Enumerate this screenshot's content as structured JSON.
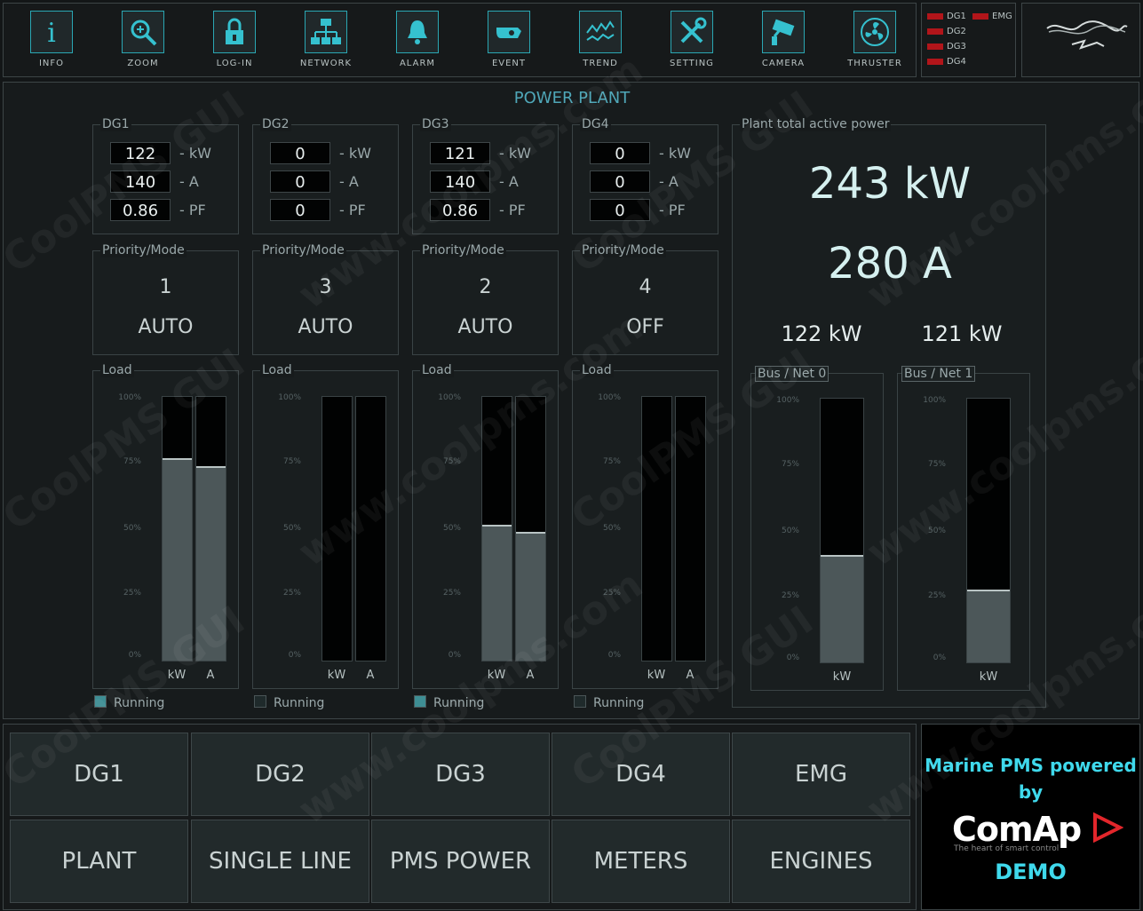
{
  "toolbar": [
    {
      "label": "INFO",
      "icon": "info-icon"
    },
    {
      "label": "ZOOM",
      "icon": "zoom-icon"
    },
    {
      "label": "LOG-IN",
      "icon": "lock-icon"
    },
    {
      "label": "NETWORK",
      "icon": "network-icon"
    },
    {
      "label": "ALARM",
      "icon": "bell-icon"
    },
    {
      "label": "EVENT",
      "icon": "event-icon"
    },
    {
      "label": "TREND",
      "icon": "trend-icon"
    },
    {
      "label": "SETTING",
      "icon": "tools-icon"
    },
    {
      "label": "CAMERA",
      "icon": "camera-icon"
    },
    {
      "label": "THRUSTER",
      "icon": "fan-icon"
    }
  ],
  "alarms": {
    "dg1": "DG1",
    "emg": "EMG",
    "dg2": "DG2",
    "dg3": "DG3",
    "dg4": "DG4",
    "led_color": "#b2151a"
  },
  "main": {
    "title": "POWER PLANT",
    "units": {
      "kw": "- kW",
      "a": "- A",
      "pf": "- PF"
    },
    "priority_label": "Priority/Mode",
    "load_label": "Load",
    "ticks": [
      "100%",
      "75%",
      "50%",
      "25%",
      "0%"
    ],
    "bar_labels": {
      "kw": "kW",
      "a": "A"
    },
    "running_label": "Running",
    "generators": [
      {
        "name": "DG1",
        "kw": "122",
        "a": "140",
        "pf": "0.86",
        "priority": "1",
        "mode": "AUTO",
        "load_kw_pct": 76,
        "load_a_pct": 73,
        "running": true
      },
      {
        "name": "DG2",
        "kw": "0",
        "a": "0",
        "pf": "0",
        "priority": "3",
        "mode": "AUTO",
        "load_kw_pct": 0,
        "load_a_pct": 0,
        "running": false
      },
      {
        "name": "DG3",
        "kw": "121",
        "a": "140",
        "pf": "0.86",
        "priority": "2",
        "mode": "AUTO",
        "load_kw_pct": 51,
        "load_a_pct": 48,
        "running": true
      },
      {
        "name": "DG4",
        "kw": "0",
        "a": "0",
        "pf": "0",
        "priority": "4",
        "mode": "OFF",
        "load_kw_pct": 0,
        "load_a_pct": 0,
        "running": false
      }
    ],
    "plant": {
      "label": "Plant total active power",
      "total_kw": "243 kW",
      "total_a": "280 A",
      "bus0_kw": "122 kW",
      "bus1_kw": "121 kW",
      "bus0_label": "Bus / Net 0",
      "bus1_label": "Bus / Net 1",
      "bus0_load_pct": 40,
      "bus1_load_pct": 27
    }
  },
  "nav": {
    "row1": [
      "DG1",
      "DG2",
      "DG3",
      "DG4",
      "EMG"
    ],
    "row2": [
      "PLANT",
      "SINGLE LINE",
      "PMS POWER",
      "METERS",
      "ENGINES"
    ]
  },
  "brand": {
    "line1": "Marine PMS powered",
    "line2": "by",
    "logo": "ComAp",
    "tagline": "The heart of smart control",
    "demo": "DEMO",
    "accent": "#3fd9ec"
  },
  "watermark": {
    "text1": "CoolPMS GUI",
    "text2": "www.coolpms.com"
  }
}
